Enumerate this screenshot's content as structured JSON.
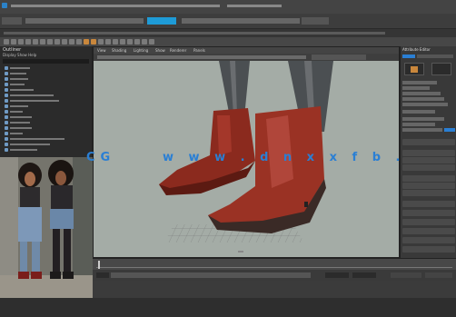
{
  "menubar": {
    "items": [
      "",
      "",
      "",
      "",
      "",
      "",
      "",
      "",
      "",
      "",
      "",
      "",
      "",
      ""
    ]
  },
  "statusline": {
    "mode": "",
    "workspace": ""
  },
  "outliner": {
    "title": "Outliner",
    "menus": [
      "Display",
      "Show",
      "Help"
    ]
  },
  "viewport": {
    "menus": [
      "View",
      "Shading",
      "Lighting",
      "Show",
      "Renderer",
      "Panels"
    ],
    "camera_label": ""
  },
  "attribute_editor": {
    "title": "Attribute Editor"
  },
  "watermark": {
    "prefix": "CG",
    "text": "w w w . d n x x f b . c n"
  },
  "colors": {
    "accent": "#2a7fd4",
    "selection": "#1e9bd7",
    "boot": "#8b2a1e"
  },
  "icons": [
    "gear-icon",
    "grid-icon",
    "camera-icon",
    "light-icon"
  ]
}
